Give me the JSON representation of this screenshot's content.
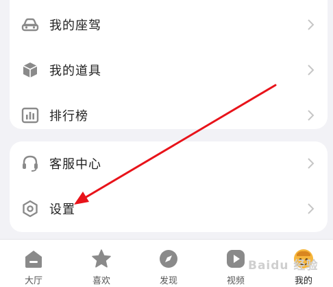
{
  "menu_top": {
    "items": [
      {
        "label": "我的座驾",
        "icon": "car-icon"
      },
      {
        "label": "我的道具",
        "icon": "box-icon"
      },
      {
        "label": "排行榜",
        "icon": "chart-bar-icon"
      }
    ]
  },
  "menu_bottom": {
    "items": [
      {
        "label": "客服中心",
        "icon": "headset-icon"
      },
      {
        "label": "设置",
        "icon": "gear-icon"
      }
    ]
  },
  "tabbar": {
    "tabs": [
      {
        "label": "大厅",
        "icon": "home-icon"
      },
      {
        "label": "喜欢",
        "icon": "star-icon"
      },
      {
        "label": "发现",
        "icon": "compass-icon"
      },
      {
        "label": "视频",
        "icon": "play-icon"
      },
      {
        "label": "我的",
        "icon": "avatar-icon",
        "active": true
      }
    ]
  },
  "watermark": {
    "text": "Baidu 经验"
  },
  "colors": {
    "background": "#f2f2f6",
    "card": "#ffffff",
    "icon_gray": "#8a8a8a",
    "arrow_red": "#e8131a",
    "avatar_orange": "#f6b63c"
  }
}
